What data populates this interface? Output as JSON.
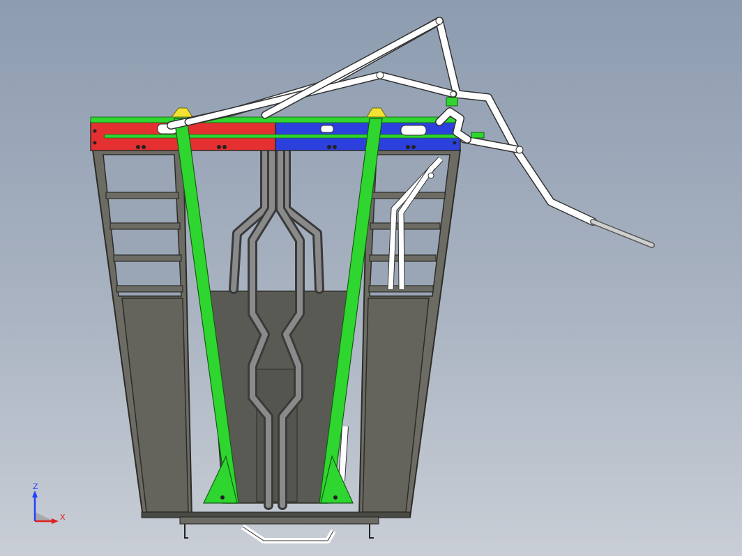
{
  "viewport": {
    "background_top": "#8d9cb0",
    "background_bottom": "#c9ced6"
  },
  "model": {
    "frame_color": "#6b6b62",
    "frame_edge": "#2f2f2a",
    "panel_color": "#5f5f58",
    "green_color": "#2fd62f",
    "red_color": "#e63232",
    "blue_color": "#2b3fe0",
    "yellow_color": "#f2e233",
    "white_arm_color": "#ffffff"
  },
  "triad": {
    "z_label": "Z",
    "x_label": "X",
    "z_color": "#2040ff",
    "x_color": "#e02020"
  }
}
